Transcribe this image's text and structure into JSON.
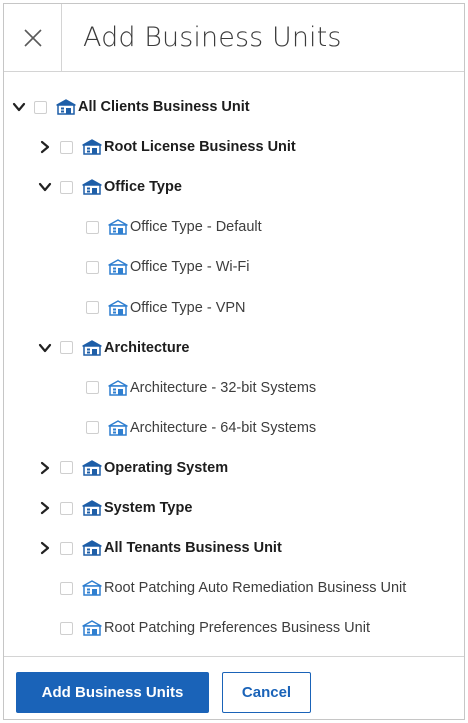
{
  "dialog": {
    "title": "Add Business Units"
  },
  "tree": {
    "items": [
      {
        "label": "All Clients Business Unit",
        "level": 0,
        "state": "expanded",
        "bold": true,
        "icon": "business-unit-icon"
      },
      {
        "label": "Root License Business Unit",
        "level": 1,
        "state": "collapsed",
        "bold": true,
        "icon": "business-unit-icon"
      },
      {
        "label": "Office Type",
        "level": 1,
        "state": "expanded",
        "bold": true,
        "icon": "business-unit-icon"
      },
      {
        "label": "Office Type - Default",
        "level": 2,
        "state": "leaf",
        "bold": false,
        "icon": "business-unit-icon"
      },
      {
        "label": "Office Type - Wi-Fi",
        "level": 2,
        "state": "leaf",
        "bold": false,
        "icon": "business-unit-icon"
      },
      {
        "label": "Office Type - VPN",
        "level": 2,
        "state": "leaf",
        "bold": false,
        "icon": "business-unit-icon"
      },
      {
        "label": "Architecture",
        "level": 1,
        "state": "expanded",
        "bold": true,
        "icon": "business-unit-icon"
      },
      {
        "label": "Architecture - 32-bit Systems",
        "level": 2,
        "state": "leaf",
        "bold": false,
        "icon": "business-unit-icon"
      },
      {
        "label": "Architecture - 64-bit Systems",
        "level": 2,
        "state": "leaf",
        "bold": false,
        "icon": "business-unit-icon"
      },
      {
        "label": "Operating System",
        "level": 1,
        "state": "collapsed",
        "bold": true,
        "icon": "business-unit-icon"
      },
      {
        "label": "System Type",
        "level": 1,
        "state": "collapsed",
        "bold": true,
        "icon": "business-unit-icon"
      },
      {
        "label": "All Tenants Business Unit",
        "level": 1,
        "state": "collapsed",
        "bold": true,
        "icon": "business-unit-icon"
      },
      {
        "label": "Root Patching Auto Remediation Business Unit",
        "level": 1,
        "state": "leaf",
        "bold": false,
        "icon": "business-unit-icon"
      },
      {
        "label": "Root Patching Preferences Business Unit",
        "level": 1,
        "state": "leaf",
        "bold": false,
        "icon": "business-unit-icon"
      }
    ]
  },
  "footer": {
    "primary_label": "Add Business Units",
    "cancel_label": "Cancel"
  },
  "colors": {
    "accent": "#1a63b8",
    "icon_dark": "#1f5fa8",
    "icon_light": "#2f7fd0"
  }
}
